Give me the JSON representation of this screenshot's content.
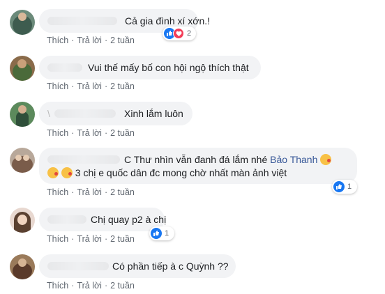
{
  "actions": {
    "like": "Thích",
    "reply": "Trả lời",
    "dot": "·"
  },
  "comments": [
    {
      "text": "Cả gia đình xí xớn.!",
      "time": "2 tuần",
      "reaction_count": "2"
    },
    {
      "text": "Vui thế mấy bố con hội ngộ thích thật",
      "time": "2 tuần"
    },
    {
      "prefix": "\\",
      "text": "Xinh lắm luôn",
      "time": "2 tuần"
    },
    {
      "line1_pre": "C Thư nhìn vẫn đanh đá lắm nhé",
      "line1_name": "Bảo Thanh",
      "line2": "3 chị e quốc dân đc mong chờ nhất màn ảnh việt",
      "time": "2 tuần",
      "reaction_count": "1"
    },
    {
      "text": "Chị quay p2 à chị",
      "time": "2 tuần",
      "reaction_count": "1"
    },
    {
      "text": "Có phần tiếp à c Quỳnh ??",
      "time": "2 tuần"
    }
  ],
  "icons": {
    "like": "thumbs-up-icon",
    "love": "heart-icon",
    "emoji": "kissing-heart-emoji-icon"
  },
  "colors": {
    "like": "#1877f2",
    "love": "#f33e58",
    "bubble": "#f2f3f5",
    "link": "#385898",
    "meta": "#606770"
  }
}
